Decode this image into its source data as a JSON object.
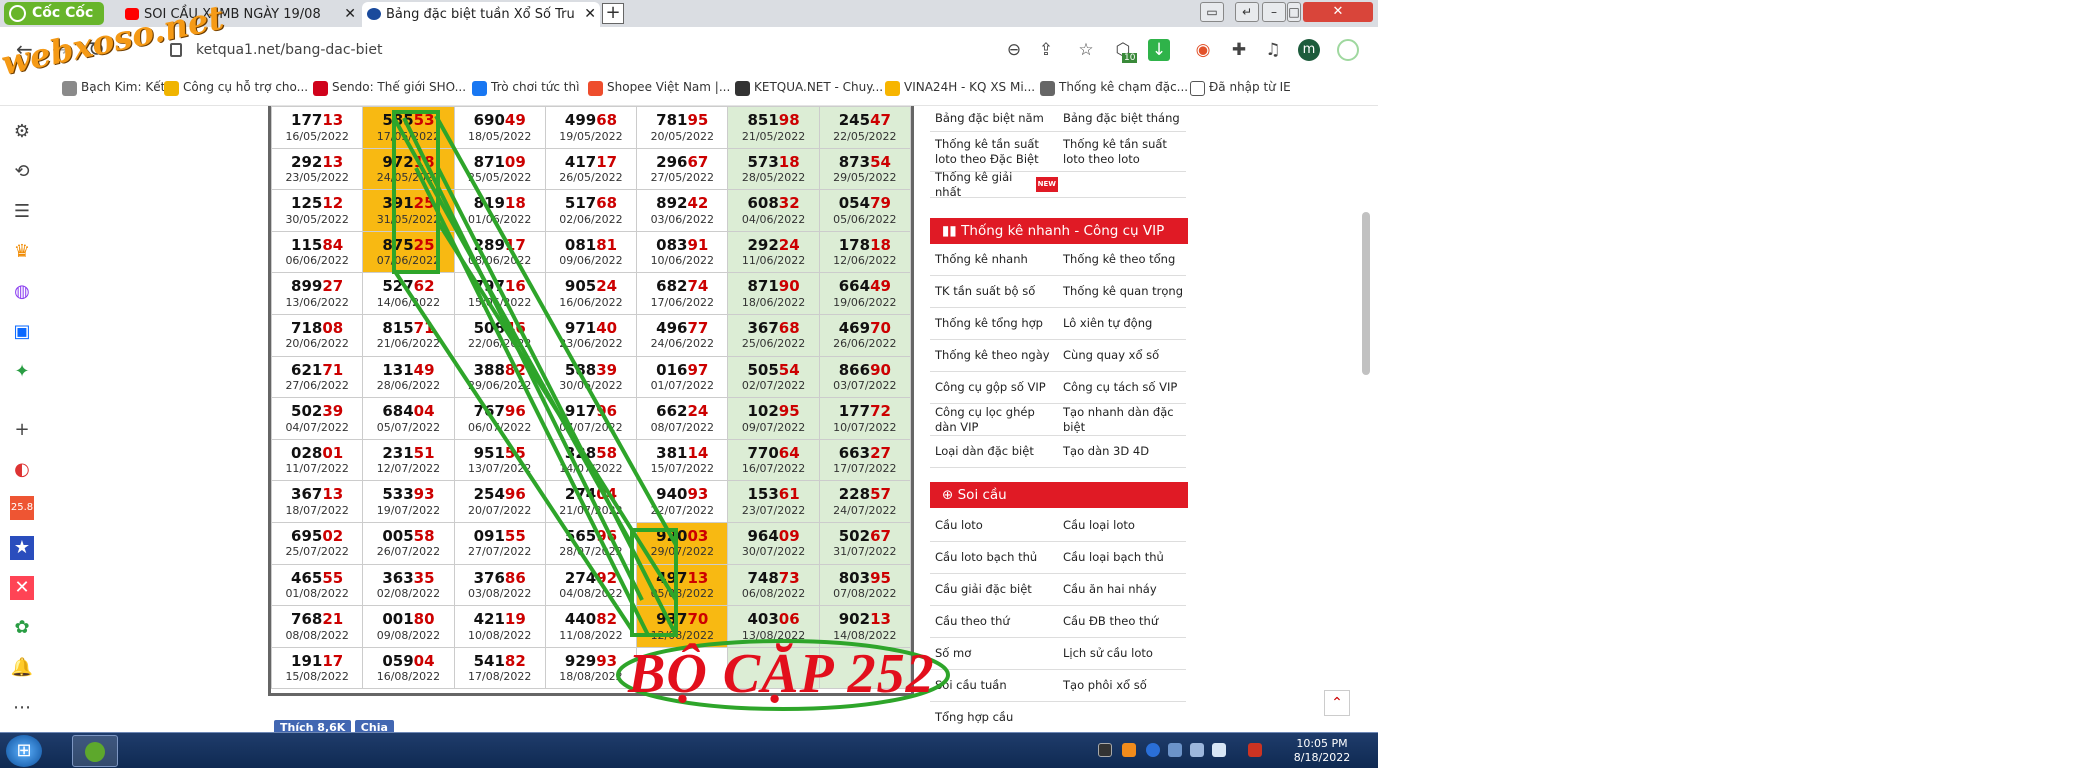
{
  "browser": {
    "brand": "Cốc Cốc",
    "tabs": [
      {
        "title": "SOI CẦU XSMB NGÀY 19/08",
        "close": "✕"
      },
      {
        "title": "Bảng đặc biệt tuần Xổ Số Tru",
        "close": "✕"
      }
    ],
    "new_tab": "+",
    "url": "ketqua1.net/bang-dac-biet",
    "download_badge": "10",
    "profile_initial": "m",
    "watermark": "webxoso.net"
  },
  "bookmarks": [
    {
      "label": "Bạch Kim: Kết...",
      "color": "#8a8a8a"
    },
    {
      "label": "Công cụ hỗ trợ cho...",
      "color": "#f0b400"
    },
    {
      "label": "Sendo: Thế giới SHO...",
      "color": "#d0021b"
    },
    {
      "label": "Trò chơi tức thì",
      "color": "#1877f2"
    },
    {
      "label": "Shopee Việt Nam |...",
      "color": "#ee4d2d"
    },
    {
      "label": "KETQUA.NET - Chuy...",
      "color": "#333333"
    },
    {
      "label": "VINA24H - KQ XS Mi...",
      "color": "#f7b500"
    },
    {
      "label": "Thống kê chạm đặc...",
      "color": "#666666"
    },
    {
      "label": "Đã nhập từ IE",
      "color": "#444444"
    }
  ],
  "table": {
    "rows": [
      [
        {
          "p": "177",
          "s": "13",
          "d": "16/05/2022"
        },
        {
          "p": "585",
          "s": "53",
          "d": "17/05/2022",
          "hl": true
        },
        {
          "p": "690",
          "s": "49",
          "d": "18/05/2022"
        },
        {
          "p": "499",
          "s": "68",
          "d": "19/05/2022"
        },
        {
          "p": "781",
          "s": "95",
          "d": "20/05/2022"
        },
        {
          "p": "851",
          "s": "98",
          "d": "21/05/2022"
        },
        {
          "p": "245",
          "s": "47",
          "d": "22/05/2022"
        }
      ],
      [
        {
          "p": "292",
          "s": "13",
          "d": "23/05/2022"
        },
        {
          "p": "972",
          "s": "18",
          "d": "24/05/2022",
          "hl": true
        },
        {
          "p": "871",
          "s": "09",
          "d": "25/05/2022"
        },
        {
          "p": "417",
          "s": "17",
          "d": "26/05/2022"
        },
        {
          "p": "296",
          "s": "67",
          "d": "27/05/2022"
        },
        {
          "p": "573",
          "s": "18",
          "d": "28/05/2022"
        },
        {
          "p": "873",
          "s": "54",
          "d": "29/05/2022"
        }
      ],
      [
        {
          "p": "125",
          "s": "12",
          "d": "30/05/2022"
        },
        {
          "p": "391",
          "s": "25",
          "d": "31/05/2022",
          "hl": true
        },
        {
          "p": "819",
          "s": "18",
          "d": "01/06/2022"
        },
        {
          "p": "517",
          "s": "68",
          "d": "02/06/2022"
        },
        {
          "p": "892",
          "s": "42",
          "d": "03/06/2022"
        },
        {
          "p": "608",
          "s": "32",
          "d": "04/06/2022"
        },
        {
          "p": "054",
          "s": "79",
          "d": "05/06/2022"
        }
      ],
      [
        {
          "p": "115",
          "s": "84",
          "d": "06/06/2022"
        },
        {
          "p": "875",
          "s": "25",
          "d": "07/06/2022",
          "hl": true
        },
        {
          "p": "289",
          "s": "17",
          "d": "08/06/2022"
        },
        {
          "p": "081",
          "s": "81",
          "d": "09/06/2022"
        },
        {
          "p": "083",
          "s": "91",
          "d": "10/06/2022"
        },
        {
          "p": "292",
          "s": "24",
          "d": "11/06/2022"
        },
        {
          "p": "178",
          "s": "18",
          "d": "12/06/2022"
        }
      ],
      [
        {
          "p": "899",
          "s": "27",
          "d": "13/06/2022"
        },
        {
          "p": "527",
          "s": "62",
          "d": "14/06/2022"
        },
        {
          "p": "797",
          "s": "16",
          "d": "15/06/2022"
        },
        {
          "p": "905",
          "s": "24",
          "d": "16/06/2022"
        },
        {
          "p": "682",
          "s": "74",
          "d": "17/06/2022"
        },
        {
          "p": "871",
          "s": "90",
          "d": "18/06/2022"
        },
        {
          "p": "664",
          "s": "49",
          "d": "19/06/2022"
        }
      ],
      [
        {
          "p": "718",
          "s": "08",
          "d": "20/06/2022"
        },
        {
          "p": "815",
          "s": "71",
          "d": "21/06/2022"
        },
        {
          "p": "508",
          "s": "46",
          "d": "22/06/2022"
        },
        {
          "p": "971",
          "s": "40",
          "d": "23/06/2022"
        },
        {
          "p": "496",
          "s": "77",
          "d": "24/06/2022"
        },
        {
          "p": "367",
          "s": "68",
          "d": "25/06/2022"
        },
        {
          "p": "469",
          "s": "70",
          "d": "26/06/2022"
        }
      ],
      [
        {
          "p": "621",
          "s": "71",
          "d": "27/06/2022"
        },
        {
          "p": "131",
          "s": "49",
          "d": "28/06/2022"
        },
        {
          "p": "388",
          "s": "82",
          "d": "29/06/2022"
        },
        {
          "p": "588",
          "s": "39",
          "d": "30/06/2022"
        },
        {
          "p": "016",
          "s": "97",
          "d": "01/07/2022"
        },
        {
          "p": "505",
          "s": "54",
          "d": "02/07/2022"
        },
        {
          "p": "866",
          "s": "90",
          "d": "03/07/2022"
        }
      ],
      [
        {
          "p": "502",
          "s": "39",
          "d": "04/07/2022"
        },
        {
          "p": "684",
          "s": "04",
          "d": "05/07/2022"
        },
        {
          "p": "767",
          "s": "96",
          "d": "06/07/2022"
        },
        {
          "p": "917",
          "s": "96",
          "d": "07/07/2022"
        },
        {
          "p": "662",
          "s": "24",
          "d": "08/07/2022"
        },
        {
          "p": "102",
          "s": "95",
          "d": "09/07/2022"
        },
        {
          "p": "177",
          "s": "72",
          "d": "10/07/2022"
        }
      ],
      [
        {
          "p": "028",
          "s": "01",
          "d": "11/07/2022"
        },
        {
          "p": "231",
          "s": "51",
          "d": "12/07/2022"
        },
        {
          "p": "951",
          "s": "55",
          "d": "13/07/2022"
        },
        {
          "p": "328",
          "s": "58",
          "d": "14/07/2022"
        },
        {
          "p": "381",
          "s": "14",
          "d": "15/07/2022"
        },
        {
          "p": "770",
          "s": "64",
          "d": "16/07/2022"
        },
        {
          "p": "663",
          "s": "27",
          "d": "17/07/2022"
        }
      ],
      [
        {
          "p": "367",
          "s": "13",
          "d": "18/07/2022"
        },
        {
          "p": "533",
          "s": "93",
          "d": "19/07/2022"
        },
        {
          "p": "254",
          "s": "96",
          "d": "20/07/2022"
        },
        {
          "p": "274",
          "s": "04",
          "d": "21/07/2022"
        },
        {
          "p": "940",
          "s": "93",
          "d": "22/07/2022"
        },
        {
          "p": "153",
          "s": "61",
          "d": "23/07/2022"
        },
        {
          "p": "228",
          "s": "57",
          "d": "24/07/2022"
        }
      ],
      [
        {
          "p": "695",
          "s": "02",
          "d": "25/07/2022"
        },
        {
          "p": "005",
          "s": "58",
          "d": "26/07/2022"
        },
        {
          "p": "091",
          "s": "55",
          "d": "27/07/2022"
        },
        {
          "p": "565",
          "s": "96",
          "d": "28/07/2022"
        },
        {
          "p": "920",
          "s": "03",
          "d": "29/07/2022",
          "hl": true
        },
        {
          "p": "964",
          "s": "09",
          "d": "30/07/2022"
        },
        {
          "p": "502",
          "s": "67",
          "d": "31/07/2022"
        }
      ],
      [
        {
          "p": "465",
          "s": "55",
          "d": "01/08/2022"
        },
        {
          "p": "363",
          "s": "35",
          "d": "02/08/2022"
        },
        {
          "p": "376",
          "s": "86",
          "d": "03/08/2022"
        },
        {
          "p": "274",
          "s": "92",
          "d": "04/08/2022"
        },
        {
          "p": "497",
          "s": "13",
          "d": "05/08/2022",
          "hl": true
        },
        {
          "p": "748",
          "s": "73",
          "d": "06/08/2022"
        },
        {
          "p": "803",
          "s": "95",
          "d": "07/08/2022"
        }
      ],
      [
        {
          "p": "768",
          "s": "21",
          "d": "08/08/2022"
        },
        {
          "p": "001",
          "s": "80",
          "d": "09/08/2022"
        },
        {
          "p": "421",
          "s": "19",
          "d": "10/08/2022"
        },
        {
          "p": "440",
          "s": "82",
          "d": "11/08/2022"
        },
        {
          "p": "937",
          "s": "70",
          "d": "12/08/2022",
          "hl": true
        },
        {
          "p": "403",
          "s": "06",
          "d": "13/08/2022"
        },
        {
          "p": "902",
          "s": "13",
          "d": "14/08/2022"
        }
      ],
      [
        {
          "p": "191",
          "s": "17",
          "d": "15/08/2022"
        },
        {
          "p": "059",
          "s": "04",
          "d": "16/08/2022"
        },
        {
          "p": "541",
          "s": "82",
          "d": "17/08/2022"
        },
        {
          "p": "929",
          "s": "93",
          "d": "18/08/2022"
        },
        {
          "p": "",
          "s": "",
          "d": ""
        },
        {
          "p": "",
          "s": "",
          "d": ""
        },
        {
          "p": "",
          "s": "",
          "d": ""
        }
      ]
    ]
  },
  "overlay": {
    "text": "BỘ CẶP 252",
    "line_color": "#2ea52a"
  },
  "right_panel": {
    "top_links": [
      [
        "Bảng đặc biệt năm",
        "Bảng đặc biệt tháng"
      ],
      [
        "Thống kê tần suất loto theo Đặc Biệt",
        "Thống kê tần suất loto theo loto"
      ],
      [
        "Thống kê giải nhất",
        ""
      ]
    ],
    "new_badge": "NEW",
    "quick_title": "Thống kê nhanh - Công cụ VIP",
    "quick_links": [
      [
        "Thống kê nhanh",
        "Thống kê theo tổng"
      ],
      [
        "TK tần suất bộ số",
        "Thống kê quan trọng"
      ],
      [
        "Thống kê tổng hợp",
        "Lô xiên tự động"
      ],
      [
        "Thống kê theo ngày",
        "Cùng quay xổ số"
      ],
      [
        "Công cụ gộp số VIP",
        "Công cụ tách số VIP"
      ],
      [
        "Công cụ lọc ghép dàn VIP",
        "Tạo nhanh dàn đặc biệt"
      ],
      [
        "Loại dàn đặc biệt",
        "Tạo dàn 3D 4D"
      ]
    ],
    "soi_title": "Soi cầu",
    "soi_links": [
      [
        "Cầu loto",
        "Cầu loại loto"
      ],
      [
        "Cầu loto bạch thủ",
        "Cầu loại bạch thủ"
      ],
      [
        "Cầu giải đặc biệt",
        "Cầu ăn hai nháy"
      ],
      [
        "Cầu theo thứ",
        "Cầu ĐB theo thứ"
      ],
      [
        "Số mơ",
        "Lịch sử cầu loto"
      ],
      [
        "Soi cầu tuần",
        "Tạo phôi xổ số"
      ],
      [
        "Tổng hợp cầu",
        ""
      ]
    ]
  },
  "social": {
    "like": "Thích 8,6K",
    "share": "Chia"
  },
  "taskbar": {
    "time": "10:05 PM",
    "date": "8/18/2022"
  }
}
